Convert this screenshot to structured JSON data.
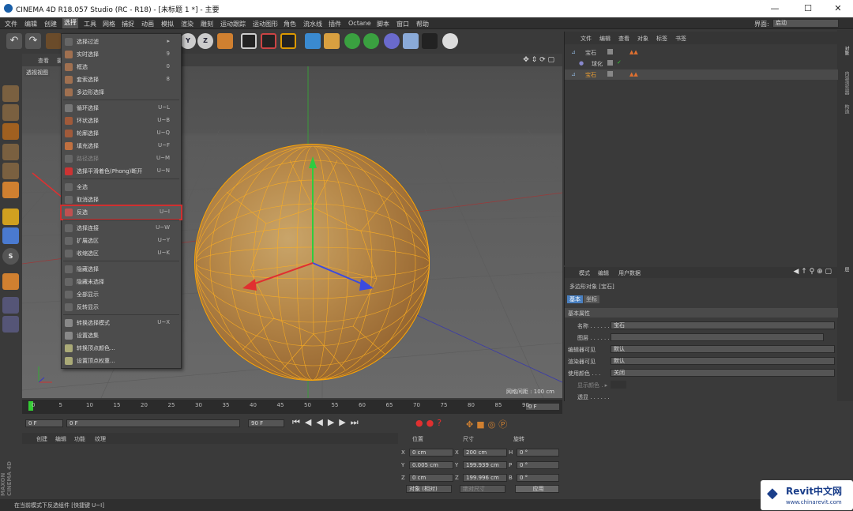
{
  "window": {
    "title": "CINEMA 4D R18.057 Studio (RC - R18) - [未标题 1 *] - 主要",
    "min": "—",
    "max": "☐",
    "close": "✕"
  },
  "menubar": {
    "items": [
      "文件",
      "编辑",
      "创建",
      "选择",
      "工具",
      "网格",
      "捕捉",
      "动画",
      "模拟",
      "渲染",
      "雕刻",
      "运动跟踪",
      "运动图形",
      "角色",
      "流水线",
      "插件",
      "Octane",
      "脚本",
      "窗口",
      "帮助"
    ],
    "layout_label": "界面:",
    "layout_value": "启动"
  },
  "viewport": {
    "header_items": [
      "查看",
      "摄"
    ],
    "label": "透视视图",
    "grid_info": "网格间距 : 100 cm"
  },
  "select_menu": {
    "rows": [
      {
        "label": "选择过滤",
        "shortcut": "▸"
      },
      {
        "label": "实时选择",
        "shortcut": "9"
      },
      {
        "label": "框选",
        "shortcut": "0"
      },
      {
        "label": "套索选择",
        "shortcut": "8"
      },
      {
        "label": "多边形选择",
        "shortcut": ""
      },
      {
        "label": "循环选择",
        "shortcut": "U~L"
      },
      {
        "label": "环状选择",
        "shortcut": "U~B"
      },
      {
        "label": "轮廓选择",
        "shortcut": "U~Q"
      },
      {
        "label": "填充选择",
        "shortcut": "U~F"
      },
      {
        "label": "路径选择",
        "shortcut": "U~M"
      },
      {
        "label": "选择平滑着色(Phong)断开",
        "shortcut": "U~N"
      },
      {
        "label": "全选",
        "shortcut": ""
      },
      {
        "label": "取消选择",
        "shortcut": ""
      },
      {
        "label": "反选",
        "shortcut": "U~I"
      },
      {
        "label": "选择连接",
        "shortcut": "U~W"
      },
      {
        "label": "扩展选区",
        "shortcut": "U~Y"
      },
      {
        "label": "收缩选区",
        "shortcut": "U~K"
      },
      {
        "label": "隐藏选择",
        "shortcut": ""
      },
      {
        "label": "隐藏未选择",
        "shortcut": ""
      },
      {
        "label": "全部显示",
        "shortcut": ""
      },
      {
        "label": "反转显示",
        "shortcut": ""
      },
      {
        "label": "转换选择模式",
        "shortcut": "U~X"
      },
      {
        "label": "设置选集",
        "shortcut": ""
      },
      {
        "label": "转换顶点颜色...",
        "shortcut": ""
      },
      {
        "label": "设置顶点权重...",
        "shortcut": ""
      }
    ]
  },
  "object_manager": {
    "menu": [
      "文件",
      "编辑",
      "查看",
      "对象",
      "标签",
      "书签"
    ],
    "objects": [
      {
        "name": "宝石",
        "color": "#dddddd"
      },
      {
        "name": "球化",
        "color": "#dddddd"
      },
      {
        "name": "宝石",
        "color": "#f0a030"
      }
    ]
  },
  "attributes": {
    "menu": [
      "模式",
      "编辑",
      "用户数据"
    ],
    "object_title": "多边形对象 [宝石]",
    "tabs": [
      "基本",
      "坐标"
    ],
    "section": "基本属性",
    "fields": [
      {
        "label": "名称 . . . . . . .",
        "value": "宝石"
      },
      {
        "label": "图层 . . . . . . .",
        "value": ""
      },
      {
        "label": "编辑器可见",
        "value": "默认"
      },
      {
        "label": "渲染器可见",
        "value": "默认"
      },
      {
        "label": "使用颜色 . . .",
        "value": "关闭"
      },
      {
        "label": "显示颜色 . ▸",
        "value": ""
      },
      {
        "label": "透显 . . . . . .",
        "value": ""
      }
    ]
  },
  "side_tabs": [
    "对象",
    "内容浏览器",
    "构造",
    "层"
  ],
  "timeline": {
    "ticks": [
      "0",
      "5",
      "10",
      "15",
      "20",
      "25",
      "30",
      "35",
      "40",
      "45",
      "50",
      "55",
      "60",
      "65",
      "70",
      "75",
      "80",
      "85",
      "90"
    ],
    "frame_end": "0 F"
  },
  "transport": {
    "current": "0 F",
    "start": "0 F",
    "end": "90 F",
    "range_end": "90 F"
  },
  "material_manager": {
    "menu": [
      "创建",
      "编辑",
      "功能",
      "纹理"
    ],
    "logo": "MAXON CINEMA 4D"
  },
  "coordinates": {
    "headers": [
      "位置",
      "尺寸",
      "旋转"
    ],
    "rows": [
      {
        "axis": "X",
        "pos": "0 cm",
        "axis2": "X",
        "size": "200 cm",
        "axis3": "H",
        "rot": "0 °"
      },
      {
        "axis": "Y",
        "pos": "0.005 cm",
        "axis2": "Y",
        "size": "199.939 cm",
        "axis3": "P",
        "rot": "0 °"
      },
      {
        "axis": "Z",
        "pos": "0 cm",
        "axis2": "Z",
        "size": "199.996 cm",
        "axis3": "B",
        "rot": "0 °"
      }
    ],
    "mode": "对象 (相对)",
    "size_mode": "绝对尺寸",
    "apply": "应用"
  },
  "status": "在当前模式下反选组件 [快捷键 U~I]",
  "watermark": {
    "brand": "Revit中文网",
    "url": "www.chinarevit.com"
  },
  "colors": {
    "accent": "#ffa500",
    "highlight": "#d03030"
  }
}
